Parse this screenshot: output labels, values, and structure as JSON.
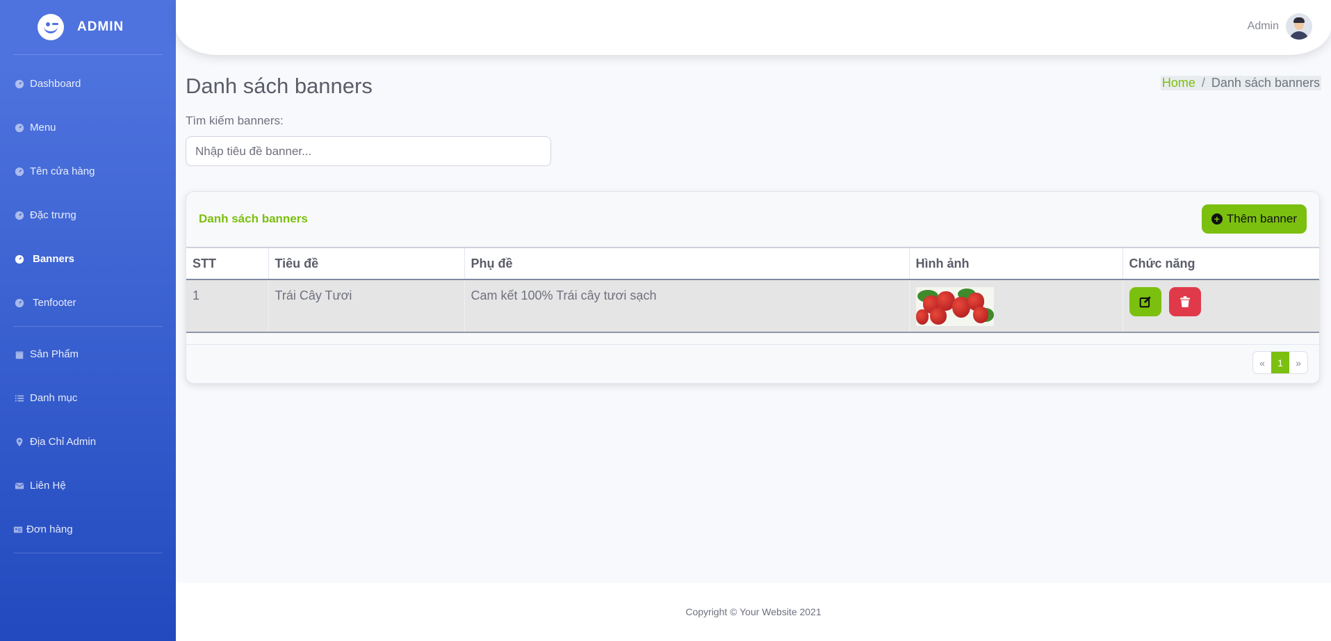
{
  "sidebar": {
    "brand": "ADMIN",
    "items": [
      {
        "label": "Dashboard",
        "icon": "gauge-icon"
      },
      {
        "label": "Menu",
        "icon": "gauge-icon"
      },
      {
        "label": "Tên cửa hàng",
        "icon": "gauge-icon"
      },
      {
        "label": "Đặc trưng",
        "icon": "gauge-icon"
      },
      {
        "label": "Banners",
        "icon": "gauge-icon",
        "active": true
      },
      {
        "label": "Tenfooter",
        "icon": "gauge-icon"
      },
      {
        "label": "Sản Phẩm",
        "icon": "calendar-icon"
      },
      {
        "label": "Danh mục",
        "icon": "list-icon"
      },
      {
        "label": "Địa Chỉ Admin",
        "icon": "map-marker-icon"
      },
      {
        "label": "Liên Hệ",
        "icon": "envelope-icon"
      },
      {
        "label": "Đơn hàng",
        "icon": "id-card-icon"
      }
    ]
  },
  "topbar": {
    "user_name": "Admin"
  },
  "page": {
    "title": "Danh sách banners",
    "breadcrumb": {
      "home": "Home",
      "separator": "/",
      "current": "Danh sách banners"
    },
    "search": {
      "label": "Tìm kiếm banners:",
      "placeholder": "Nhập tiêu đề banner...",
      "value": ""
    }
  },
  "card": {
    "title": "Danh sách banners",
    "add_button": "Thêm banner",
    "columns": [
      "STT",
      "Tiêu đề",
      "Phụ đề",
      "Hình ảnh",
      "Chức năng"
    ],
    "rows": [
      {
        "stt": "1",
        "title": "Trái Cây Tươi",
        "subtitle": "Cam kết 100% Trái cây tươi sạch",
        "image": "strawberries"
      }
    ],
    "pagination": {
      "prev": "«",
      "current": "1",
      "next": "»"
    }
  },
  "footer": {
    "copyright": "Copyright © Your Website 2021"
  },
  "colors": {
    "sidebar_top": "#4e73df",
    "sidebar_bottom": "#224abe",
    "accent": "#7bc00f",
    "danger": "#e03a4a"
  }
}
